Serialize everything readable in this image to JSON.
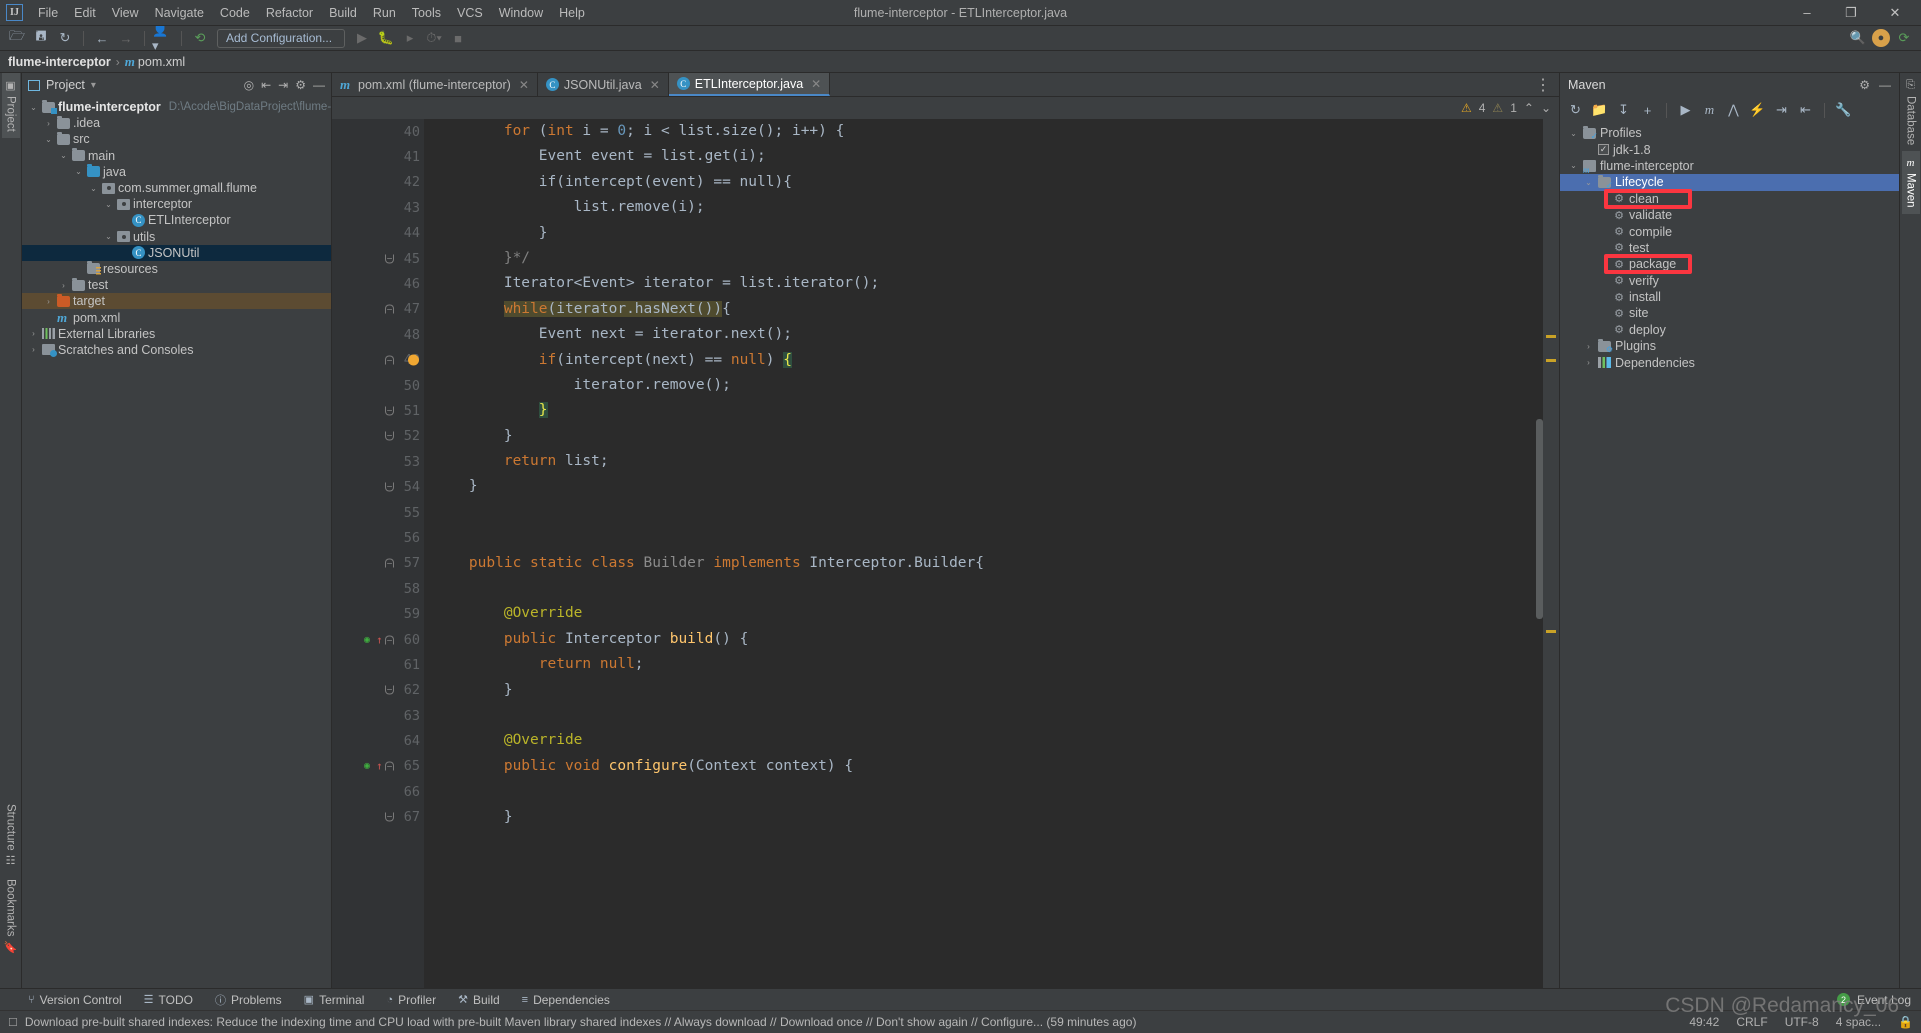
{
  "window": {
    "title": "flume-interceptor - ETLInterceptor.java",
    "logo": "IJ",
    "minimize": "–",
    "maximize": "❐",
    "close": "✕"
  },
  "menubar": [
    "File",
    "Edit",
    "View",
    "Navigate",
    "Code",
    "Refactor",
    "Build",
    "Run",
    "Tools",
    "VCS",
    "Window",
    "Help"
  ],
  "toolbar": {
    "open_icon": "open-folder-icon",
    "save_icon": "save-icon",
    "sync_icon": "sync-icon",
    "back_icon": "back-arrow-icon",
    "forward_icon": "forward-arrow-icon",
    "profile_icon": "user-profile-icon",
    "build_icon": "hammer-icon",
    "run_config": "Add Configuration...",
    "run_icon": "run-icon",
    "debug_icon": "debug-icon",
    "coverage_icon": "run-coverage-icon",
    "profiler_icon": "profiler-icon",
    "stop_icon": "stop-icon",
    "search_icon": "search-icon",
    "avatar_label": "●",
    "updates_icon": "updates-icon"
  },
  "breadcrumb": {
    "project": "flume-interceptor",
    "separator": "›",
    "file": "pom.xml",
    "file_icon": "maven-m-icon"
  },
  "left_stripe": [
    {
      "label": "Project",
      "icon": "project-icon",
      "active": true
    },
    {
      "label": "Structure",
      "icon": "structure-icon",
      "active": false
    },
    {
      "label": "Bookmarks",
      "icon": "bookmarks-icon",
      "active": false
    }
  ],
  "right_stripe": [
    {
      "label": "Database",
      "icon": "database-icon",
      "active": false
    },
    {
      "label": "Maven",
      "icon": "maven-m-icon",
      "active": true
    }
  ],
  "project_panel": {
    "title": "Project",
    "dropdown": "▾",
    "icons": [
      "locate-icon",
      "expand-all-icon",
      "collapse-all-icon",
      "settings-gear-icon",
      "hide-panel-icon"
    ],
    "tree": [
      {
        "label": "flume-interceptor",
        "path": "D:\\Acode\\BigDataProject\\flume-intercep",
        "indent": 0,
        "arrow": "⌄",
        "icon": "module-folder-icon",
        "bold": true
      },
      {
        "label": ".idea",
        "indent": 1,
        "arrow": "›",
        "icon": "folder-icon"
      },
      {
        "label": "src",
        "indent": 1,
        "arrow": "⌄",
        "icon": "folder-icon"
      },
      {
        "label": "main",
        "indent": 2,
        "arrow": "⌄",
        "icon": "folder-icon"
      },
      {
        "label": "java",
        "indent": 3,
        "arrow": "⌄",
        "icon": "source-folder-icon"
      },
      {
        "label": "com.summer.gmall.flume",
        "indent": 4,
        "arrow": "⌄",
        "icon": "package-icon"
      },
      {
        "label": "interceptor",
        "indent": 5,
        "arrow": "⌄",
        "icon": "package-icon"
      },
      {
        "label": "ETLInterceptor",
        "indent": 6,
        "arrow": "",
        "icon": "java-class-icon"
      },
      {
        "label": "utils",
        "indent": 5,
        "arrow": "⌄",
        "icon": "package-icon"
      },
      {
        "label": "JSONUtil",
        "indent": 6,
        "arrow": "",
        "icon": "java-class-icon",
        "selected": true
      },
      {
        "label": "resources",
        "indent": 3,
        "arrow": "",
        "icon": "resources-folder-icon"
      },
      {
        "label": "test",
        "indent": 2,
        "arrow": "›",
        "icon": "folder-icon"
      },
      {
        "label": "target",
        "indent": 1,
        "arrow": "›",
        "icon": "excluded-folder-icon",
        "highlight": "target"
      },
      {
        "label": "pom.xml",
        "indent": 1,
        "arrow": "",
        "icon": "maven-m-icon"
      },
      {
        "label": "External Libraries",
        "indent": 0,
        "arrow": "›",
        "icon": "libraries-icon"
      },
      {
        "label": "Scratches and Consoles",
        "indent": 0,
        "arrow": "›",
        "icon": "scratches-icon"
      }
    ]
  },
  "editor": {
    "tabs": [
      {
        "label": "pom.xml (flume-interceptor)",
        "icon": "maven-m-icon",
        "active": false,
        "close": "✕"
      },
      {
        "label": "JSONUtil.java",
        "icon": "java-class-icon",
        "active": false,
        "close": "✕"
      },
      {
        "label": "ETLInterceptor.java",
        "icon": "java-class-icon",
        "active": true,
        "close": "✕"
      }
    ],
    "options_icon": "⋮",
    "inspection": {
      "warning_icon": "warning-triangle-icon",
      "warning_count": "4",
      "weak_warning_icon": "weak-warning-triangle-icon",
      "weak_warning_count": "1",
      "prev_icon": "⌃",
      "next_icon": "⌄"
    },
    "first_line": 40,
    "lines": [
      {
        "n": 40,
        "tokens": [
          {
            "t": "        for ",
            "c": "kw"
          },
          {
            "t": "(",
            "c": "txt"
          },
          {
            "t": "int",
            "c": "kw"
          },
          {
            "t": " i = ",
            "c": "txt"
          },
          {
            "t": "0",
            "c": "num2"
          },
          {
            "t": "; i < list.size(); i++) {",
            "c": "txt"
          }
        ]
      },
      {
        "n": 41,
        "tokens": [
          {
            "t": "            Event event = list.get(i);",
            "c": "txt"
          }
        ]
      },
      {
        "n": 42,
        "tokens": [
          {
            "t": "            if(intercept(event) == null){",
            "c": "txt"
          }
        ]
      },
      {
        "n": 43,
        "tokens": [
          {
            "t": "                list.remove(i);",
            "c": "txt"
          }
        ]
      },
      {
        "n": 44,
        "tokens": [
          {
            "t": "            }",
            "c": "txt"
          }
        ]
      },
      {
        "n": 45,
        "tokens": [
          {
            "t": "        }*/",
            "c": "cmt"
          }
        ],
        "fold": "bottom"
      },
      {
        "n": 46,
        "tokens": [
          {
            "t": "        Iterator<Event> iterator = list.iterator();",
            "c": "txt"
          }
        ]
      },
      {
        "n": 47,
        "tokens": [
          {
            "t": "while",
            "c": "kw hl"
          },
          {
            "t": "(iterator.hasNext())",
            "c": "txt hl"
          },
          {
            "t": "{",
            "c": "txt"
          }
        ],
        "indent": "        ",
        "fold": "top"
      },
      {
        "n": 48,
        "tokens": [
          {
            "t": "            Event next = iterator.next();",
            "c": "txt"
          }
        ]
      },
      {
        "n": 49,
        "tokens": [
          {
            "t": "            ",
            "c": "txt"
          },
          {
            "t": "if",
            "c": "kw"
          },
          {
            "t": "(intercept(next) == ",
            "c": "txt"
          },
          {
            "t": "null",
            "c": "kw"
          },
          {
            "t": ") ",
            "c": "txt"
          },
          {
            "t": "{",
            "c": "brk gr-hl"
          }
        ],
        "fold": "top",
        "bulb": true,
        "current": true
      },
      {
        "n": 50,
        "tokens": [
          {
            "t": "                iterator.remove();",
            "c": "txt"
          }
        ]
      },
      {
        "n": 51,
        "tokens": [
          {
            "t": "            ",
            "c": "txt"
          },
          {
            "t": "}",
            "c": "brk gr-hl"
          }
        ],
        "fold": "bottom"
      },
      {
        "n": 52,
        "tokens": [
          {
            "t": "        }",
            "c": "txt"
          }
        ],
        "fold": "bottom"
      },
      {
        "n": 53,
        "tokens": [
          {
            "t": "        ",
            "c": "txt"
          },
          {
            "t": "return",
            "c": "kw"
          },
          {
            "t": " list;",
            "c": "txt"
          }
        ]
      },
      {
        "n": 54,
        "tokens": [
          {
            "t": "    }",
            "c": "txt"
          }
        ],
        "fold": "bottom"
      },
      {
        "n": 55,
        "tokens": [
          {
            "t": "",
            "c": "txt"
          }
        ]
      },
      {
        "n": 56,
        "tokens": [
          {
            "t": "",
            "c": "txt"
          }
        ]
      },
      {
        "n": 57,
        "tokens": [
          {
            "t": "    ",
            "c": "txt"
          },
          {
            "t": "public static class ",
            "c": "kw"
          },
          {
            "t": "Builder",
            "c": "cls-gray"
          },
          {
            "t": " ",
            "c": "txt"
          },
          {
            "t": "implements ",
            "c": "kw"
          },
          {
            "t": "Interceptor.Builder",
            "c": "type"
          },
          {
            "t": "{",
            "c": "txt"
          }
        ],
        "fold": "top"
      },
      {
        "n": 58,
        "tokens": [
          {
            "t": "",
            "c": "txt"
          }
        ]
      },
      {
        "n": 59,
        "tokens": [
          {
            "t": "        @Override",
            "c": "ann"
          }
        ]
      },
      {
        "n": 60,
        "tokens": [
          {
            "t": "        ",
            "c": "txt"
          },
          {
            "t": "public ",
            "c": "kw"
          },
          {
            "t": "Interceptor ",
            "c": "type"
          },
          {
            "t": "build",
            "c": "fn"
          },
          {
            "t": "() {",
            "c": "txt"
          }
        ],
        "fold": "top",
        "override": true
      },
      {
        "n": 61,
        "tokens": [
          {
            "t": "            ",
            "c": "txt"
          },
          {
            "t": "return null",
            "c": "kw"
          },
          {
            "t": ";",
            "c": "txt"
          }
        ]
      },
      {
        "n": 62,
        "tokens": [
          {
            "t": "        }",
            "c": "txt"
          }
        ],
        "fold": "bottom"
      },
      {
        "n": 63,
        "tokens": [
          {
            "t": "",
            "c": "txt"
          }
        ]
      },
      {
        "n": 64,
        "tokens": [
          {
            "t": "        @Override",
            "c": "ann"
          }
        ]
      },
      {
        "n": 65,
        "tokens": [
          {
            "t": "        ",
            "c": "txt"
          },
          {
            "t": "public void ",
            "c": "kw"
          },
          {
            "t": "configure",
            "c": "fn"
          },
          {
            "t": "(",
            "c": "txt"
          },
          {
            "t": "Context",
            "c": "type"
          },
          {
            "t": " context) {",
            "c": "txt"
          }
        ],
        "fold": "top",
        "override": true
      },
      {
        "n": 66,
        "tokens": [
          {
            "t": "",
            "c": "txt"
          }
        ]
      },
      {
        "n": 67,
        "tokens": [
          {
            "t": "        }",
            "c": "txt"
          }
        ],
        "fold": "bottom"
      }
    ]
  },
  "maven_panel": {
    "title": "Maven",
    "settings_icon": "settings-gear-icon",
    "hide_icon": "hide-panel-icon",
    "toolbar_icons": [
      "reload-all-icon",
      "add-maven-project-icon",
      "download-sources-icon",
      "add-icon",
      "execute-goal-icon",
      "maven-m-icon",
      "toggle-skip-tests-icon",
      "toggle-offline-icon",
      "expand-all-icon",
      "collapse-all-icon",
      "wrench-icon"
    ],
    "tree": [
      {
        "label": "Profiles",
        "indent": 0,
        "arrow": "⌄",
        "icon": "profiles-folder-icon"
      },
      {
        "label": "jdk-1.8",
        "indent": 1,
        "arrow": "",
        "icon": "checkbox-icon",
        "checked": true
      },
      {
        "label": "flume-interceptor",
        "indent": 0,
        "arrow": "⌄",
        "icon": "maven-project-icon"
      },
      {
        "label": "Lifecycle",
        "indent": 1,
        "arrow": "⌄",
        "icon": "lifecycle-folder-icon",
        "selected": true
      },
      {
        "label": "clean",
        "indent": 2,
        "arrow": "",
        "icon": "maven-goal-icon",
        "annotated": true
      },
      {
        "label": "validate",
        "indent": 2,
        "arrow": "",
        "icon": "maven-goal-icon"
      },
      {
        "label": "compile",
        "indent": 2,
        "arrow": "",
        "icon": "maven-goal-icon"
      },
      {
        "label": "test",
        "indent": 2,
        "arrow": "",
        "icon": "maven-goal-icon"
      },
      {
        "label": "package",
        "indent": 2,
        "arrow": "",
        "icon": "maven-goal-icon",
        "annotated": true
      },
      {
        "label": "verify",
        "indent": 2,
        "arrow": "",
        "icon": "maven-goal-icon"
      },
      {
        "label": "install",
        "indent": 2,
        "arrow": "",
        "icon": "maven-goal-icon"
      },
      {
        "label": "site",
        "indent": 2,
        "arrow": "",
        "icon": "maven-goal-icon"
      },
      {
        "label": "deploy",
        "indent": 2,
        "arrow": "",
        "icon": "maven-goal-icon"
      },
      {
        "label": "Plugins",
        "indent": 1,
        "arrow": "›",
        "icon": "plugins-folder-icon"
      },
      {
        "label": "Dependencies",
        "indent": 1,
        "arrow": "›",
        "icon": "dependencies-icon"
      }
    ]
  },
  "bottom_toolwindows": [
    {
      "label": "Version Control",
      "icon": "branch-icon"
    },
    {
      "label": "TODO",
      "icon": "todo-list-icon"
    },
    {
      "label": "Problems",
      "icon": "problems-icon"
    },
    {
      "label": "Terminal",
      "icon": "terminal-icon"
    },
    {
      "label": "Profiler",
      "icon": "profiler-icon"
    },
    {
      "label": "Build",
      "icon": "hammer-icon"
    },
    {
      "label": "Dependencies",
      "icon": "dependencies-icon"
    }
  ],
  "event_log": {
    "count": "2",
    "label": "Event Log"
  },
  "statusbar": {
    "icon": "message-icon",
    "message": "Download pre-built shared indexes: Reduce the indexing time and CPU load with pre-built Maven library shared indexes // Always download // Download once // Don't show again // Configure... (59 minutes ago)",
    "caret": "49:42",
    "line_separator": "CRLF",
    "encoding": "UTF-8",
    "indent": "4 spac...",
    "lock_icon": "lock-icon"
  },
  "watermark": "CSDN @Redamancy_06",
  "colors": {
    "accent_blue": "#4b6eaf",
    "annotation_red": "#fb3640",
    "selection_navy": "#0d293e",
    "editor_bg": "#2b2b2b",
    "panel_bg": "#3c3f41",
    "gutter_bg": "#313335"
  }
}
